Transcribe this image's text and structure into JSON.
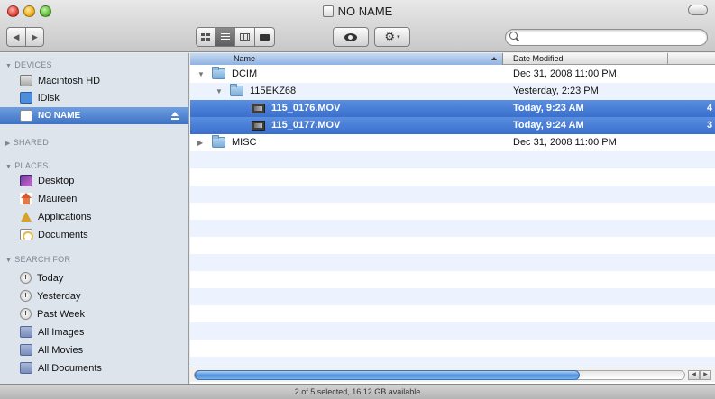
{
  "window": {
    "title": "NO NAME"
  },
  "toolbar": {
    "back_label": "◀",
    "forward_label": "▶",
    "search_placeholder": "",
    "search_glyph": "Q"
  },
  "sidebar": {
    "sections": {
      "devices": "DEVICES",
      "shared": "SHARED",
      "places": "PLACES",
      "search_for": "SEARCH FOR"
    },
    "devices": [
      {
        "label": "Macintosh HD",
        "icon": "hard-drive-icon"
      },
      {
        "label": "iDisk",
        "icon": "idisk-icon"
      },
      {
        "label": "NO NAME",
        "icon": "removable-drive-icon",
        "selected": true
      }
    ],
    "places": [
      {
        "label": "Desktop",
        "icon": "desktop-icon"
      },
      {
        "label": "Maureen",
        "icon": "home-icon"
      },
      {
        "label": "Applications",
        "icon": "applications-icon"
      },
      {
        "label": "Documents",
        "icon": "documents-icon"
      }
    ],
    "search_for": [
      {
        "label": "Today",
        "icon": "clock-icon"
      },
      {
        "label": "Yesterday",
        "icon": "clock-icon"
      },
      {
        "label": "Past Week",
        "icon": "clock-icon"
      },
      {
        "label": "All Images",
        "icon": "smart-folder-icon"
      },
      {
        "label": "All Movies",
        "icon": "smart-folder-icon"
      },
      {
        "label": "All Documents",
        "icon": "smart-folder-icon"
      }
    ]
  },
  "list": {
    "columns": {
      "name": "Name",
      "date_modified": "Date Modified"
    },
    "rows": [
      {
        "name": "DCIM",
        "date": "Dec 31, 2008 11:00 PM",
        "size": "",
        "kind": "folder",
        "expanded": true,
        "selected": false
      },
      {
        "name": "115EKZ68",
        "date": "Yesterday, 2:23 PM",
        "size": "",
        "kind": "folder",
        "expanded": true,
        "selected": false
      },
      {
        "name": "115_0176.MOV",
        "date": "Today, 9:23 AM",
        "size": "4",
        "kind": "movie",
        "selected": true
      },
      {
        "name": "115_0177.MOV",
        "date": "Today, 9:24 AM",
        "size": "3",
        "kind": "movie",
        "selected": true
      },
      {
        "name": "MISC",
        "date": "Dec 31, 2008 11:00 PM",
        "size": "",
        "kind": "folder",
        "expanded": false,
        "selected": false
      }
    ]
  },
  "status": {
    "text": "2 of 5 selected, 16.12 GB available"
  },
  "colors": {
    "selection": "#3a6fcc",
    "sidebar_bg": "#dde4ec",
    "row_alt": "#edf3fe"
  }
}
